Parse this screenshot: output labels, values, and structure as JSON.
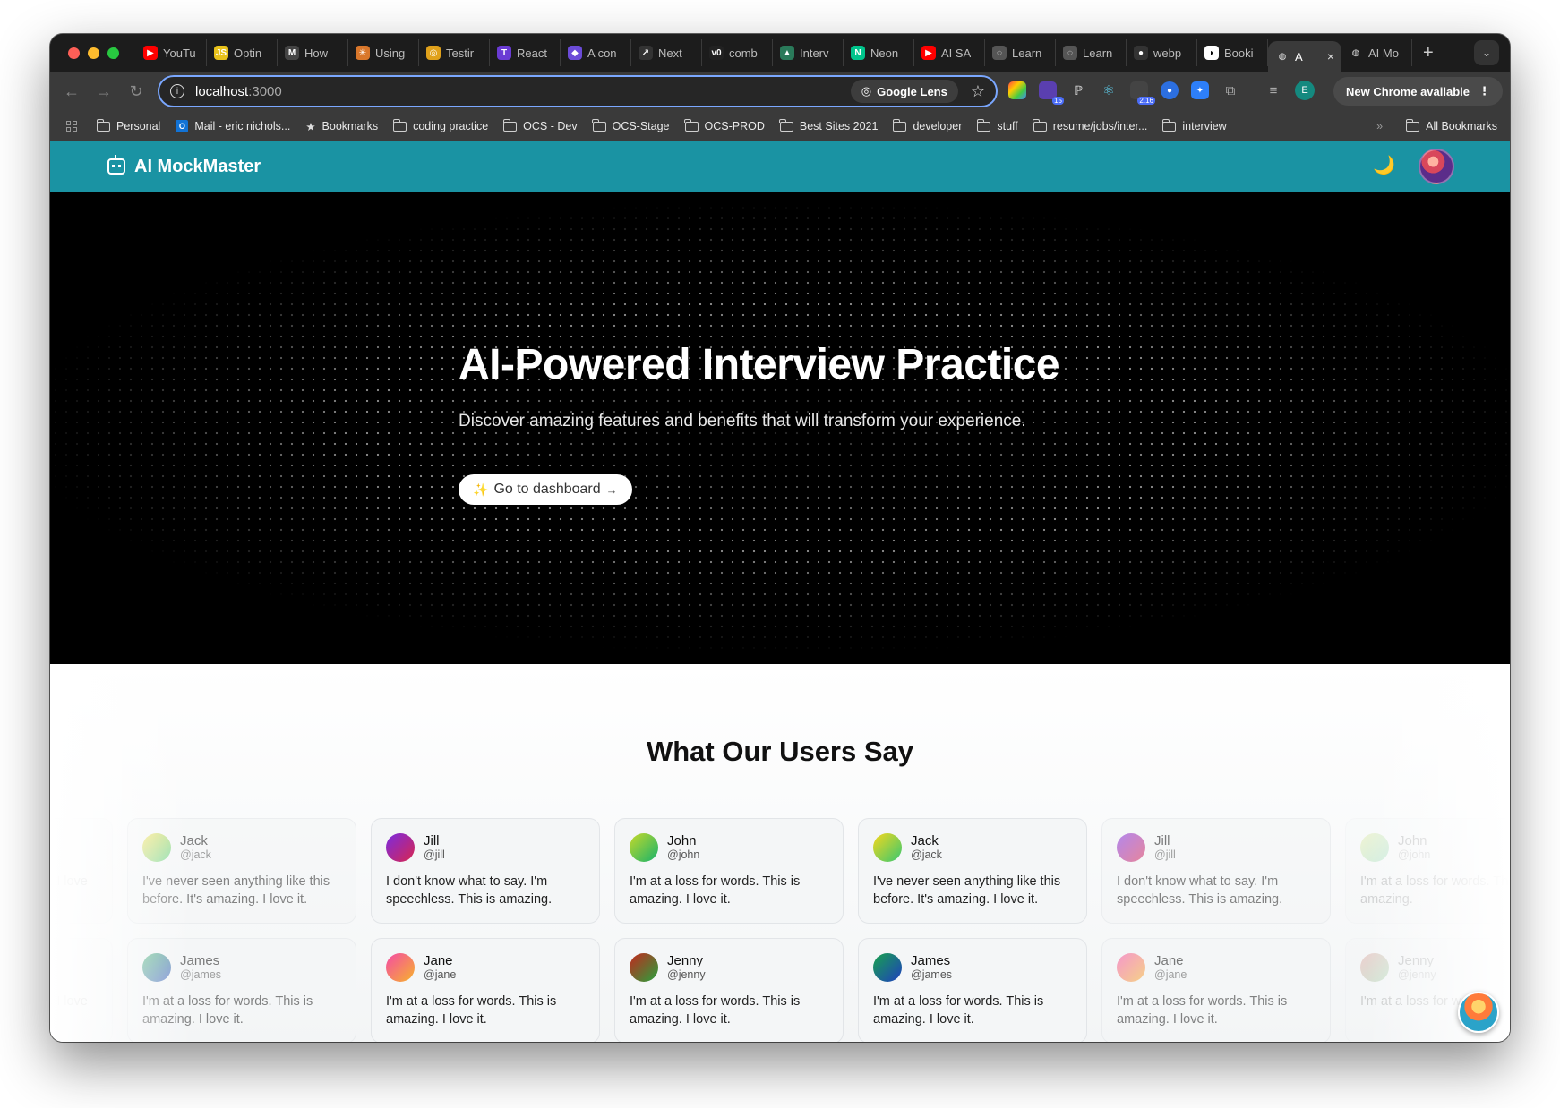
{
  "browser": {
    "tabs": [
      {
        "label": "YouTu",
        "color": "#ff0000",
        "glyph": "▶"
      },
      {
        "label": "Optin",
        "color": "#e9c21a",
        "glyph": "JS"
      },
      {
        "label": "How",
        "color": "#444444",
        "glyph": "M"
      },
      {
        "label": "Using",
        "color": "#d9772b",
        "glyph": "✳"
      },
      {
        "label": "Testir",
        "color": "#e0a11b",
        "glyph": "◎"
      },
      {
        "label": "React",
        "color": "#6a3bd4",
        "glyph": "T"
      },
      {
        "label": "A con",
        "color": "#6b4bd8",
        "glyph": "◆"
      },
      {
        "label": "Next",
        "color": "#333333",
        "glyph": "↗"
      },
      {
        "label": "comb",
        "color": "#222222",
        "glyph": "v0"
      },
      {
        "label": "Interv",
        "color": "#2a7a5a",
        "glyph": "▲"
      },
      {
        "label": "Neon",
        "color": "#00c48c",
        "glyph": "N"
      },
      {
        "label": "AI SA",
        "color": "#ff0000",
        "glyph": "▶"
      },
      {
        "label": "Learn",
        "color": "#555555",
        "glyph": "◌"
      },
      {
        "label": "Learn",
        "color": "#555555",
        "glyph": "◌"
      },
      {
        "label": "webp",
        "color": "#333333",
        "glyph": "●"
      },
      {
        "label": "Booki",
        "color": "#ffffff",
        "glyph": "◗"
      }
    ],
    "active_tab": {
      "label": "A",
      "close": "×"
    },
    "extra_tab": {
      "label": "AI Mo"
    },
    "new_tab": "+",
    "url_host": "localhost",
    "url_port": ":3000",
    "google_lens": "Google Lens",
    "profile_initial": "E",
    "update_button": "New Chrome available",
    "extension_badges": [
      "15",
      "2.16"
    ],
    "bookmarks": [
      {
        "label": "Personal",
        "type": "folder"
      },
      {
        "label": "Mail - eric nichols...",
        "type": "outlook"
      },
      {
        "label": "Bookmarks",
        "type": "star"
      },
      {
        "label": "coding practice",
        "type": "folder"
      },
      {
        "label": "OCS - Dev",
        "type": "folder"
      },
      {
        "label": "OCS-Stage",
        "type": "folder"
      },
      {
        "label": "OCS-PROD",
        "type": "folder"
      },
      {
        "label": "Best Sites 2021",
        "type": "folder"
      },
      {
        "label": "developer",
        "type": "folder"
      },
      {
        "label": "stuff",
        "type": "folder"
      },
      {
        "label": "resume/jobs/inter...",
        "type": "folder"
      },
      {
        "label": "interview",
        "type": "folder"
      }
    ],
    "bookmarks_overflow": "»",
    "all_bookmarks": "All Bookmarks"
  },
  "site": {
    "brand": "AI MockMaster",
    "theme_icon": "🌙",
    "hero": {
      "title": "AI-Powered Interview Practice",
      "subtitle": "Discover amazing features and benefits that will transform your experience.",
      "cta": "Go to dashboard",
      "cta_icon": "✨",
      "cta_arrow": "→"
    },
    "testimonials_title": "What Our Users Say",
    "row1": [
      {
        "name": "",
        "handle": "",
        "text": "for words. This is amazing. I love it.",
        "avatar": "g-john",
        "state": "faint"
      },
      {
        "name": "Jack",
        "handle": "@jack",
        "text": "I've never seen anything like this before. It's amazing. I love it.",
        "avatar": "g-jack",
        "state": "fade"
      },
      {
        "name": "Jill",
        "handle": "@jill",
        "text": "I don't know what to say. I'm speechless. This is amazing.",
        "avatar": "g-jill",
        "state": ""
      },
      {
        "name": "John",
        "handle": "@john",
        "text": "I'm at a loss for words. This is amazing. I love it.",
        "avatar": "g-john",
        "state": ""
      },
      {
        "name": "Jack",
        "handle": "@jack",
        "text": "I've never seen anything like this before. It's amazing. I love it.",
        "avatar": "g-jack",
        "state": ""
      },
      {
        "name": "Jill",
        "handle": "@jill",
        "text": "I don't know what to say. I'm speechless. This is amazing.",
        "avatar": "g-jill",
        "state": "fade"
      },
      {
        "name": "John",
        "handle": "@john",
        "text": "I'm at a loss for words. This is amazing.",
        "avatar": "g-john",
        "state": "faint"
      }
    ],
    "row2": [
      {
        "name": "",
        "handle": "",
        "text": "for words. This is amazing. I love it.",
        "avatar": "g-jenny",
        "state": "faint"
      },
      {
        "name": "James",
        "handle": "@james",
        "text": "I'm at a loss for words. This is amazing. I love it.",
        "avatar": "g-james",
        "state": "fade"
      },
      {
        "name": "Jane",
        "handle": "@jane",
        "text": "I'm at a loss for words. This is amazing. I love it.",
        "avatar": "g-jane",
        "state": ""
      },
      {
        "name": "Jenny",
        "handle": "@jenny",
        "text": "I'm at a loss for words. This is amazing. I love it.",
        "avatar": "g-jenny",
        "state": ""
      },
      {
        "name": "James",
        "handle": "@james",
        "text": "I'm at a loss for words. This is amazing. I love it.",
        "avatar": "g-james",
        "state": ""
      },
      {
        "name": "Jane",
        "handle": "@jane",
        "text": "I'm at a loss for words. This is amazing. I love it.",
        "avatar": "g-jane",
        "state": "fade"
      },
      {
        "name": "Jenny",
        "handle": "@jenny",
        "text": "I'm at a loss for words.",
        "avatar": "g-jenny",
        "state": "faint"
      }
    ]
  },
  "colors": {
    "header_bg": "#1a93a3",
    "hero_bg": "#000000",
    "omnibox_focus": "#7aa7ff"
  }
}
